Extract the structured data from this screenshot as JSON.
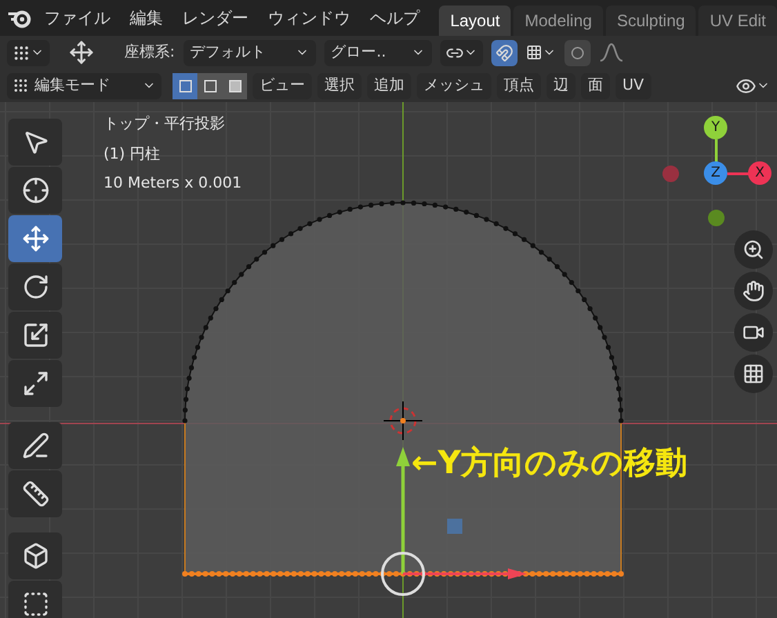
{
  "menu": [
    "ファイル",
    "編集",
    "レンダー",
    "ウィンドウ",
    "ヘルプ"
  ],
  "workspaces": [
    {
      "label": "Layout",
      "selected": true
    },
    {
      "label": "Modeling",
      "selected": false
    },
    {
      "label": "Sculpting",
      "selected": false
    },
    {
      "label": "UV Edit",
      "selected": false
    }
  ],
  "tool_header": {
    "orientation_label": "座標系:",
    "pivot": "デフォルト",
    "orientation": "グロー..",
    "snap": {
      "on": true
    },
    "proportional": {
      "on": false
    }
  },
  "edit_header": {
    "mode": "編集モード",
    "select_modes": [
      {
        "kind": "vertex",
        "selected": true
      },
      {
        "kind": "edge",
        "selected": false
      },
      {
        "kind": "face",
        "selected": false
      }
    ],
    "menus": [
      "ビュー",
      "選択",
      "追加",
      "メッシュ",
      "頂点",
      "辺",
      "面",
      "UV"
    ]
  },
  "viewport": {
    "info": [
      "トップ・平行投影",
      "(1) 円柱",
      "10 Meters x 0.001"
    ],
    "toolbar": [
      {
        "kind": "select",
        "selected": false
      },
      {
        "kind": "cursor",
        "selected": false
      },
      {
        "kind": "move",
        "selected": true
      },
      {
        "kind": "rotate",
        "selected": false
      },
      {
        "kind": "scale",
        "selected": false
      },
      {
        "kind": "transform",
        "selected": false
      },
      {
        "kind": "annotate",
        "selected": false
      },
      {
        "kind": "measure",
        "selected": false
      },
      {
        "kind": "extrude",
        "selected": false
      },
      {
        "kind": "inset",
        "selected": false
      }
    ],
    "gizmo": {
      "y": "Y",
      "z": "Z",
      "x": "X"
    },
    "annotation": "←Y方向のみの移動"
  }
}
